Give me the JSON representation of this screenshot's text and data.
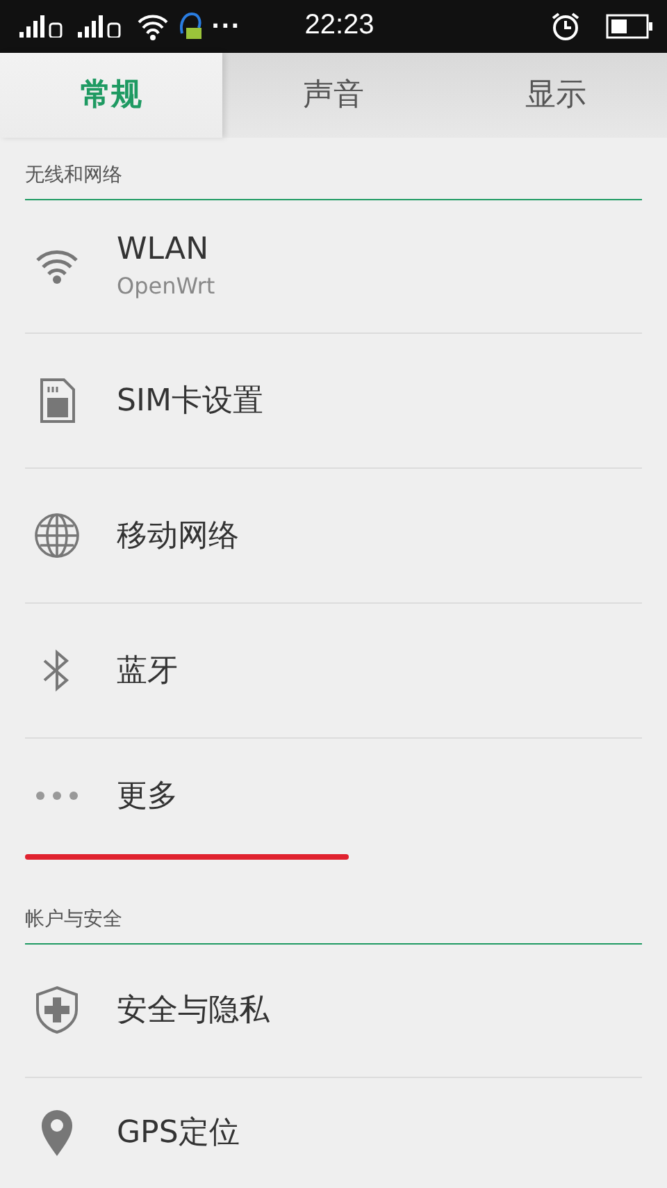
{
  "status_bar": {
    "time": "22:23",
    "notification_more": "···"
  },
  "tabs": [
    {
      "label": "常规",
      "selected": true
    },
    {
      "label": "声音",
      "selected": false
    },
    {
      "label": "显示",
      "selected": false
    }
  ],
  "sections": [
    {
      "title": "无线和网络",
      "items": [
        {
          "label": "WLAN",
          "subtitle": "OpenWrt"
        },
        {
          "label": "SIM卡设置"
        },
        {
          "label": "移动网络"
        },
        {
          "label": "蓝牙"
        },
        {
          "label": "更多"
        }
      ]
    },
    {
      "title": "帐户与安全",
      "items": [
        {
          "label": "安全与隐私"
        },
        {
          "label": "GPS定位"
        }
      ]
    }
  ]
}
